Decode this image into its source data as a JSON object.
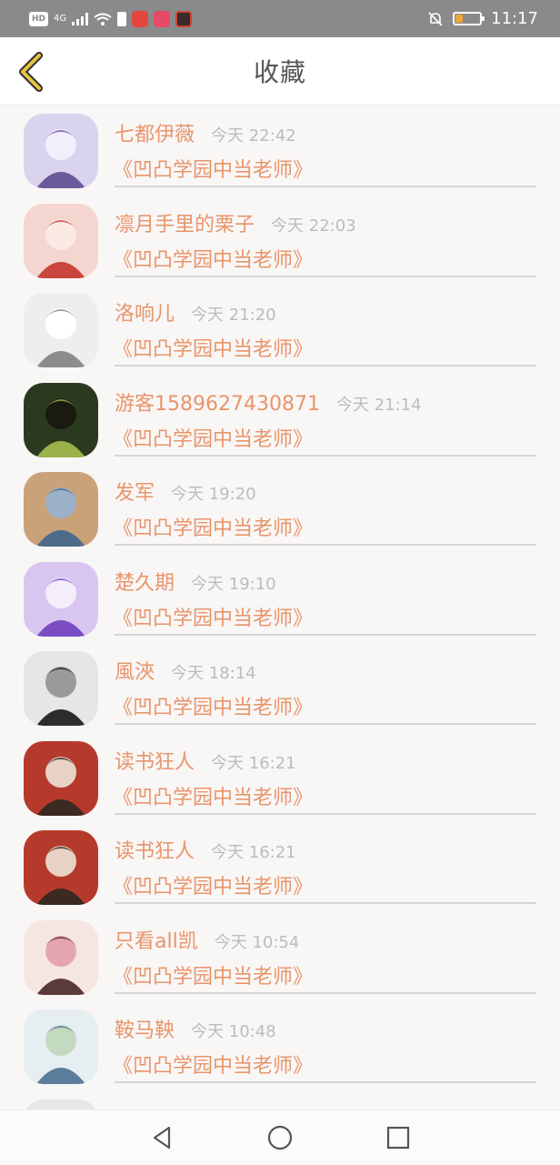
{
  "status_bar": {
    "hd": "HD",
    "network": "4G",
    "time": "11:17",
    "icons": [
      "hd-icon",
      "signal-icon",
      "wifi-icon",
      "alert-icon",
      "app-red-icon",
      "app-pink-icon",
      "app-game-icon",
      "mute-bell-icon",
      "battery-icon"
    ],
    "battery_level": 0.2
  },
  "header": {
    "title": "收藏",
    "back_icon": "chevron-left-icon",
    "accent": "#e7c23e"
  },
  "colors": {
    "name": "#e8956a",
    "time": "#bcbcbc",
    "divider": "#d6d6d6"
  },
  "items": [
    {
      "name": "七都伊薇",
      "time": "今天 22:42",
      "book": "《凹凸学园中当老师》"
    },
    {
      "name": "凛月手里的栗子",
      "time": "今天 22:03",
      "book": "《凹凸学园中当老师》"
    },
    {
      "name": "洛响儿",
      "time": "今天 21:20",
      "book": "《凹凸学园中当老师》"
    },
    {
      "name": "游客1589627430871",
      "time": "今天 21:14",
      "book": "《凹凸学园中当老师》"
    },
    {
      "name": "发军",
      "time": "今天 19:20",
      "book": "《凹凸学园中当老师》"
    },
    {
      "name": "楚久期",
      "time": "今天 19:10",
      "book": "《凹凸学园中当老师》"
    },
    {
      "name": "風浹",
      "time": "今天 18:14",
      "book": "《凹凸学园中当老师》"
    },
    {
      "name": "读书狂人",
      "time": "今天 16:21",
      "book": "《凹凸学园中当老师》"
    },
    {
      "name": "读书狂人",
      "time": "今天 16:21",
      "book": "《凹凸学园中当老师》"
    },
    {
      "name": "只看all凯",
      "time": "今天 10:54",
      "book": "《凹凸学园中当老师》"
    },
    {
      "name": "鞍马鞅",
      "time": "今天 10:48",
      "book": "《凹凸学园中当老师》"
    }
  ],
  "nav": {
    "back": "triangle-back-icon",
    "home": "circle-home-icon",
    "recent": "square-recent-icon"
  }
}
